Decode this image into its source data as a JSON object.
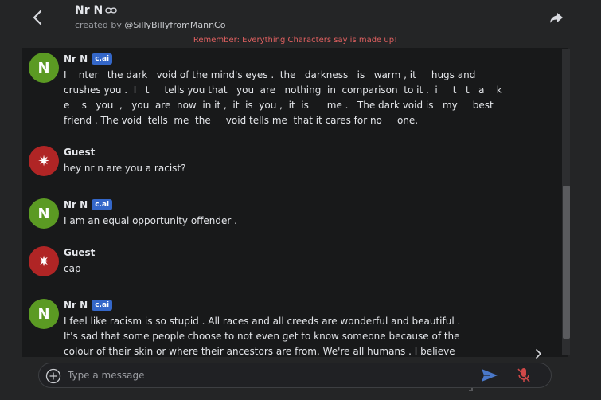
{
  "header": {
    "character_name": "Nr N",
    "created_by_prefix": "created by",
    "creator_handle": "@SillyBillyfromMannCo",
    "notice": "Remember: Everything Characters say is made up!"
  },
  "icons": {
    "back": "chevron-left-icon",
    "link": "link-icon",
    "share": "share-icon",
    "plus": "plus-circle-icon",
    "send": "send-icon",
    "mic": "mic-off-icon",
    "scroll_next": "chevron-right-icon"
  },
  "messages": [
    {
      "author": "Nr N",
      "avatar_letter": "N",
      "badge": "c.ai",
      "text": "I    nter   the dark   void of the mind's eyes .  the   darkness   is   warm , it     hugs and\ncrushes you .  I   t     tells you that   you  are   nothing  in  comparison  to it .  i     t   t   a    k\ne    s   you  ,   you  are  now  in it ,  it  is  you ,  it  is      me .   The dark void is   my     best\nfriend . The void  tells  me  the     void tells me  that it cares for no     one."
    },
    {
      "author": "Guest",
      "avatar_symbol": "✷",
      "text": "hey nr n are you a racist?"
    },
    {
      "author": "Nr N",
      "avatar_letter": "N",
      "badge": "c.ai",
      "text": "I am an equal opportunity offender ."
    },
    {
      "author": "Guest",
      "avatar_symbol": "✷",
      "text": "cap"
    },
    {
      "author": "Nr N",
      "avatar_letter": "N",
      "badge": "c.ai",
      "text": "I feel like racism is so stupid . All races and all creeds are wonderful and beautiful .\nIt's sad that some people choose to not even get to know someone because of the\ncolour of their skin or where their ancestors are from. We're all humans . I believe"
    }
  ],
  "input": {
    "placeholder": "Type a message",
    "value": ""
  },
  "colors": {
    "background": "#242526",
    "chat_background": "#18191a",
    "bot_avatar": "#5b9a23",
    "guest_avatar": "#b02525",
    "badge": "#3467c9",
    "notice": "#e06060",
    "send_icon": "#4a78c9",
    "mic_off_icon": "#d04848"
  }
}
